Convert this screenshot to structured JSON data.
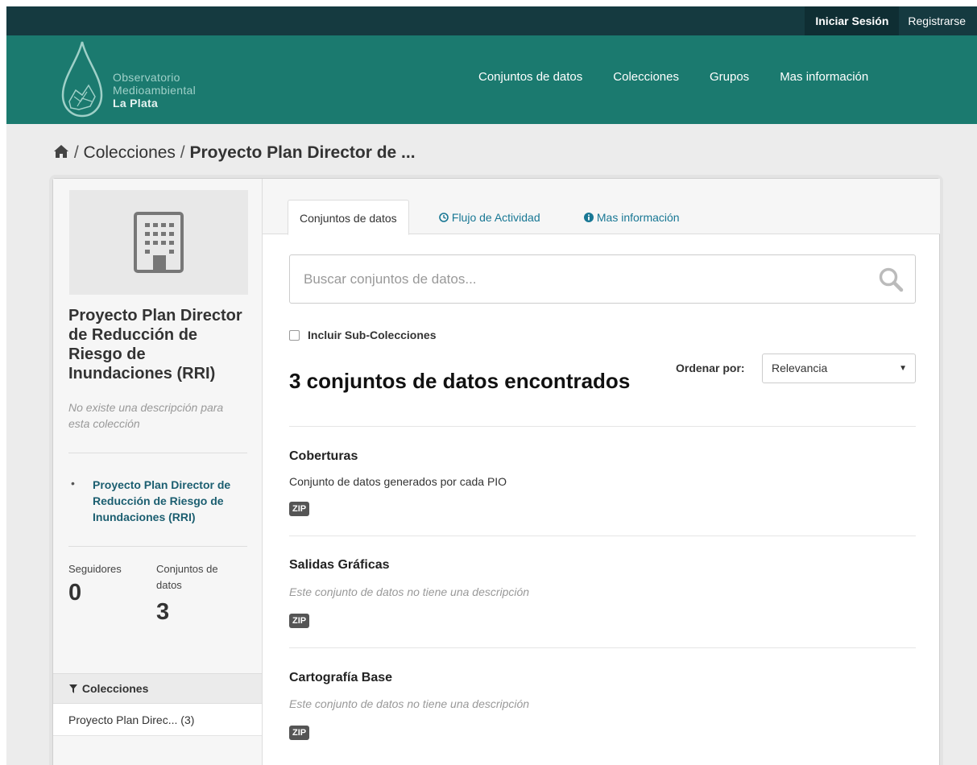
{
  "topbar": {
    "login": "Iniciar Sesión",
    "register": "Registrarse"
  },
  "site": {
    "logo_line1": "Observatorio",
    "logo_line2": "Medioambiental",
    "logo_line3": "La Plata"
  },
  "nav": [
    "Conjuntos de datos",
    "Colecciones",
    "Grupos",
    "Mas información"
  ],
  "breadcrumb": {
    "separator": "/",
    "section": "Colecciones",
    "current": "Proyecto Plan Director de ..."
  },
  "collection": {
    "title": "Proyecto Plan Director de Reducción de Riesgo de Inundaciones (RRI)",
    "description": "No existe una descripción para esta colección",
    "tree_item": "Proyecto Plan Director de Reducción de Riesgo de Inundaciones (RRI)",
    "followers_label": "Seguidores",
    "followers": "0",
    "datasets_label": "Conjuntos de datos",
    "datasets": "3"
  },
  "facet": {
    "title": "Colecciones",
    "item": "Proyecto Plan Direc... (3)"
  },
  "tabs": {
    "datasets": "Conjuntos de datos",
    "activity": "Flujo de Actividad",
    "about": "Mas información"
  },
  "search": {
    "placeholder": "Buscar conjuntos de datos...",
    "value": ""
  },
  "include_sub": "Incluir Sub-Colecciones",
  "results_count": "3 conjuntos de datos encontrados",
  "sort": {
    "label": "Ordenar por:",
    "selected": "Relevancia"
  },
  "datasets": [
    {
      "title": "Coberturas",
      "description": "Conjunto de datos generados por cada PIO",
      "format": "ZIP"
    },
    {
      "title": "Salidas Gráficas",
      "description": "Este conjunto de datos no tiene una descripción",
      "format": "ZIP"
    },
    {
      "title": "Cartografía Base",
      "description": "Este conjunto de datos no tiene una descripción",
      "format": "ZIP"
    }
  ],
  "colors": {
    "topbar": "#153a40",
    "masthead": "#1b7a6f",
    "link": "#187794",
    "background": "#ececec"
  }
}
